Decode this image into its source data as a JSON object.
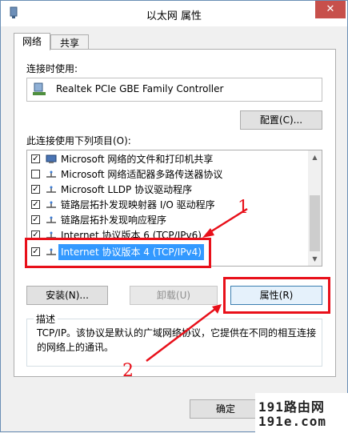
{
  "window": {
    "title": "以太网 属性",
    "close_label": "✕"
  },
  "tabs": [
    {
      "label": "网络"
    },
    {
      "label": "共享"
    }
  ],
  "connect_using": {
    "label": "连接时使用:",
    "adapter": "Realtek PCIe GBE Family Controller",
    "configure_button": "配置(C)..."
  },
  "items_section": {
    "label": "此连接使用下列项目(O):",
    "items": [
      {
        "label": "Microsoft 网络的文件和打印机共享",
        "checked": true,
        "mark": "✓",
        "icon": "network-client-icon"
      },
      {
        "label": "Microsoft 网络适配器多路传送器协议",
        "checked": false,
        "mark": "",
        "icon": "protocol-icon"
      },
      {
        "label": "Microsoft LLDP 协议驱动程序",
        "checked": true,
        "mark": "✓",
        "icon": "protocol-icon"
      },
      {
        "label": "链路层拓扑发现映射器 I/O 驱动程序",
        "checked": true,
        "mark": "✓",
        "icon": "protocol-icon"
      },
      {
        "label": "链路层拓扑发现响应程序",
        "checked": true,
        "mark": "✓",
        "icon": "protocol-icon"
      },
      {
        "label": "Internet 协议版本 6 (TCP/IPv6)",
        "checked": true,
        "mark": "✓",
        "icon": "protocol-icon"
      },
      {
        "label": "Internet 协议版本 4 (TCP/IPv4)",
        "checked": true,
        "mark": "✓",
        "icon": "protocol-icon",
        "selected": true
      }
    ]
  },
  "buttons": {
    "install": "安装(N)...",
    "uninstall": "卸载(U)",
    "properties": "属性(R)",
    "ok": "确定"
  },
  "description": {
    "label": "描述",
    "text": "TCP/IP。该协议是默认的广域网络协议，它提供在不同的相互连接的网络上的通讯。"
  },
  "annotations": {
    "one": "1",
    "two": "2"
  },
  "watermark": {
    "line1": "191路由网",
    "line2": "191e.com"
  },
  "colors": {
    "accent": "#3399ff",
    "annotation": "#e8101a"
  }
}
